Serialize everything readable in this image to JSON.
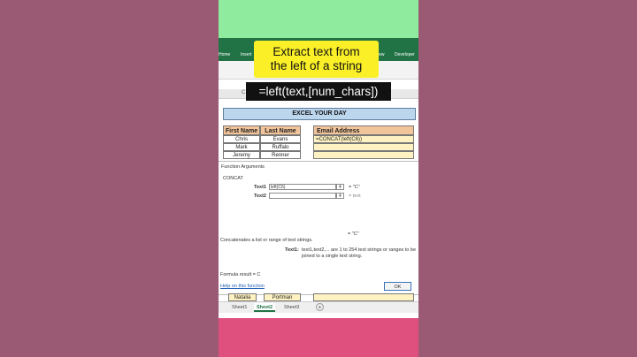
{
  "ribbon": {
    "tabs": [
      "Home",
      "Insert",
      "iew",
      "Developer"
    ]
  },
  "overlay": {
    "title_line1": "Extract text from",
    "title_line2": "the left of a string",
    "formula": "=left(text,[num_chars])"
  },
  "sheet": {
    "column_header": "C",
    "banner": "EXCEL YOUR DAY",
    "headers": {
      "first": "First Name",
      "last": "Last Name",
      "email": "Email Address"
    },
    "rows": [
      {
        "first": "Chris",
        "last": "Evans",
        "email": "=CONCAT(left(C6))"
      },
      {
        "first": "Mark",
        "last": "Ruffalo",
        "email": ""
      },
      {
        "first": "Jeremy",
        "last": "Renner",
        "email": ""
      }
    ],
    "bottom_row": {
      "first": "Natalia",
      "last": "Portman"
    }
  },
  "dialog": {
    "title": "Function Arguments",
    "function_name": "CONCAT",
    "arg1_label": "Text1",
    "arg1_value": "left(C6)",
    "arg1_result": "= \"C\"",
    "arg2_label": "Text2",
    "arg2_result": "= text",
    "result_mid": "= \"C\"",
    "description": "Concatenates a list or range of text strings.",
    "arg_desc_label": "Text1:",
    "arg_desc": "text1,text2,... are 1 to 254 text strings or ranges to be joined to a single text string.",
    "formula_result": "Formula result =   C",
    "help_link": "Help on this function",
    "ok": "OK",
    "collapse_glyph": "⇞"
  },
  "tabs": {
    "sheet1": "Sheet1",
    "sheet2": "Sheet2",
    "sheet3": "Sheet3",
    "add": "+"
  }
}
